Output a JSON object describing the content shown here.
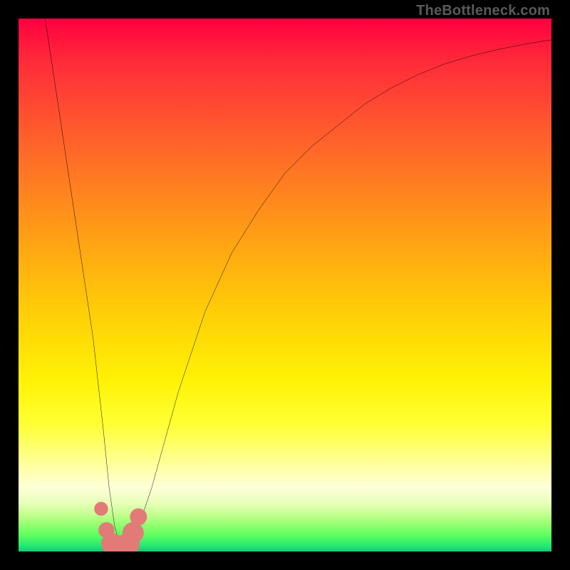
{
  "attribution": "TheBottleneck.com",
  "chart_data": {
    "type": "line",
    "title": "",
    "xlabel": "",
    "ylabel": "",
    "xlim": [
      0,
      100
    ],
    "ylim": [
      0,
      100
    ],
    "series": [
      {
        "name": "main-curve",
        "x": [
          5,
          8,
          11,
          14,
          16,
          17,
          18,
          19,
          20,
          22,
          25,
          30,
          35,
          40,
          45,
          50,
          55,
          60,
          65,
          70,
          75,
          80,
          85,
          90,
          95,
          100
        ],
        "y": [
          100,
          80,
          60,
          40,
          22,
          12,
          5,
          1,
          0,
          3,
          12,
          30,
          45,
          56,
          64,
          71,
          76,
          80,
          84,
          87,
          89.5,
          91.5,
          93,
          94.2,
          95.2,
          96
        ]
      }
    ],
    "markers": [
      {
        "x": 15.5,
        "y": 8,
        "r": 1.3
      },
      {
        "x": 16.5,
        "y": 4,
        "r": 1.5
      },
      {
        "x": 17.5,
        "y": 1.5,
        "r": 2.0
      },
      {
        "x": 18.5,
        "y": 0.9,
        "r": 2.2
      },
      {
        "x": 19.5,
        "y": 0.7,
        "r": 2.2
      },
      {
        "x": 20.5,
        "y": 1.3,
        "r": 2.2
      },
      {
        "x": 21.5,
        "y": 3.5,
        "r": 2.0
      },
      {
        "x": 22.5,
        "y": 6.5,
        "r": 1.6
      }
    ],
    "colors": {
      "curve": "#000000",
      "marker": "#e27a78"
    }
  }
}
